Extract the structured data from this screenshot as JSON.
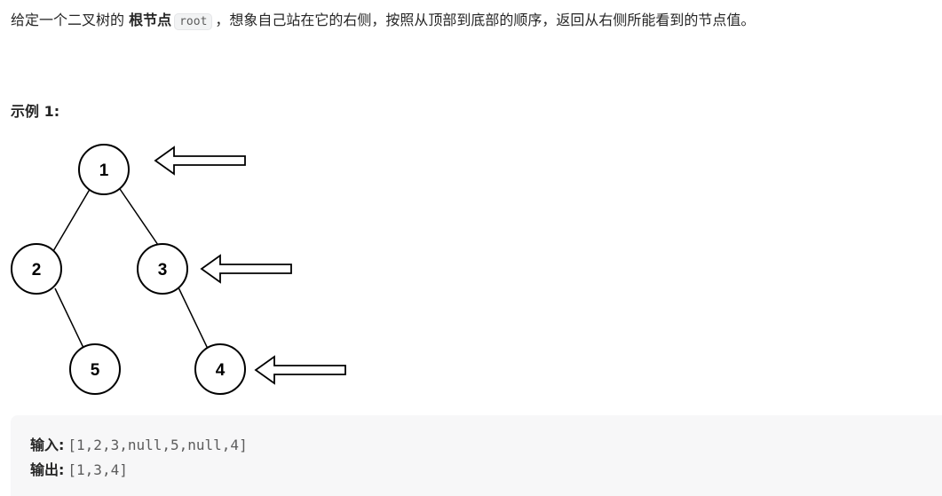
{
  "description": {
    "prefix": "给定一个二叉树的 ",
    "bold_term": "根节点",
    "code_term": "root",
    "suffix": "，想象自己站在它的右侧，按照从顶部到底部的顺序，返回从右侧所能看到的节点值。"
  },
  "example": {
    "title": "示例 1:",
    "tree": {
      "nodes": [
        {
          "id": "node-1",
          "label": "1"
        },
        {
          "id": "node-2",
          "label": "2"
        },
        {
          "id": "node-3",
          "label": "3"
        },
        {
          "id": "node-5",
          "label": "5"
        },
        {
          "id": "node-4",
          "label": "4"
        }
      ],
      "edges": [
        [
          "1",
          "2"
        ],
        [
          "1",
          "3"
        ],
        [
          "2",
          "5"
        ],
        [
          "3",
          "4"
        ]
      ],
      "arrows_point_to": [
        "1",
        "3",
        "4"
      ]
    },
    "input_label": "输入:",
    "input_value": "[1,2,3,null,5,null,4]",
    "output_label": "输出:",
    "output_value": "[1,3,4]"
  }
}
